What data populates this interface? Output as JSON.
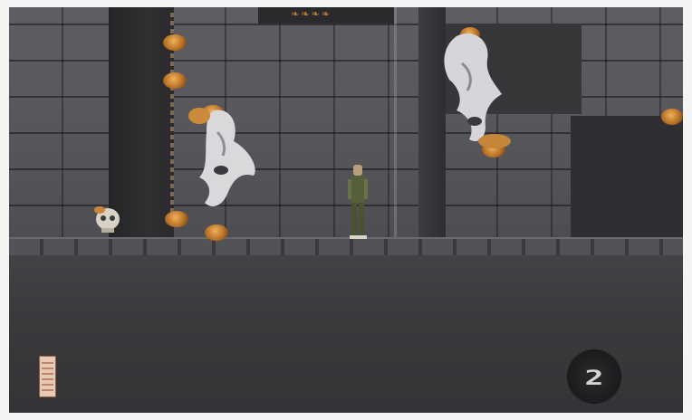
{
  "game": {
    "hud": {
      "lives_remaining": "2",
      "energy_level": 1.0
    },
    "colors": {
      "wall": "#5a5a5e",
      "floor": "#3a3a3d",
      "flame": "#e19a45",
      "ghost": "#dcdcdc"
    },
    "icons": [
      "lives-counter-icon",
      "energy-meter-icon",
      "ghost-icon",
      "flame-orb-icon",
      "player-knight-icon",
      "skull-icon"
    ]
  }
}
